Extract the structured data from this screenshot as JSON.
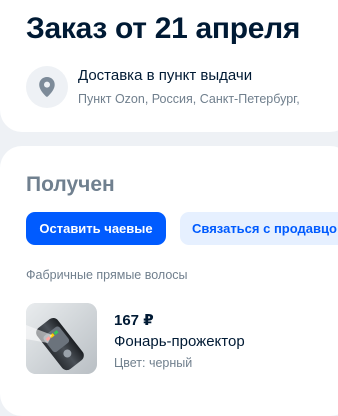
{
  "order": {
    "title": "Заказ от 21 апреля"
  },
  "delivery": {
    "icon": "location-pin-icon",
    "title": "Доставка в пункт выдачи",
    "address": "Пункт Ozon, Россия, Санкт-Петербург,"
  },
  "status": {
    "title": "Получен",
    "buttons": {
      "tip": "Оставить чаевые",
      "contact": "Связаться с продавцо"
    }
  },
  "items": {
    "section_label": "Фабричные прямые волосы",
    "product": {
      "price": "167 ₽",
      "name": "Фонарь-прожектор",
      "color": "Цвет: черный",
      "image": "flashlight-product-photo"
    }
  },
  "colors": {
    "accent": "#005bff",
    "accent_light": "#e6f0ff",
    "background": "#eef1f5",
    "text": "#001a34",
    "muted": "#707f8d"
  }
}
